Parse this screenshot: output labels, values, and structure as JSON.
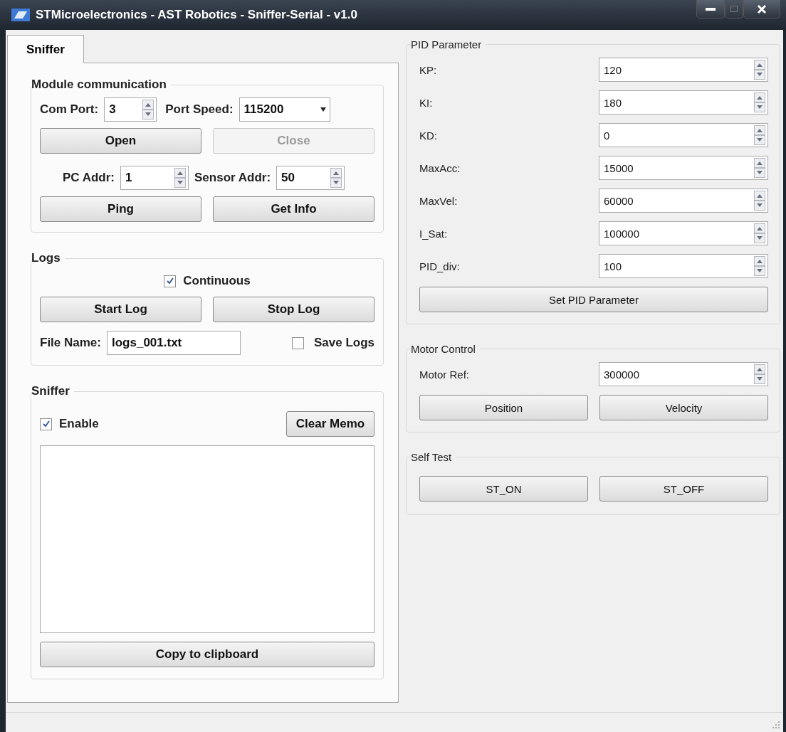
{
  "window": {
    "title": "STMicroelectronics - AST Robotics - Sniffer-Serial - v1.0"
  },
  "tabs": [
    {
      "label": "Sniffer",
      "selected": true
    }
  ],
  "module_communication": {
    "title": "Module communication",
    "com_port": {
      "label": "Com Port:",
      "value": "3"
    },
    "port_speed": {
      "label": "Port Speed:",
      "value": "115200"
    },
    "connect_buttons": [
      {
        "label": "Open",
        "disabled": false
      },
      {
        "label": "Close",
        "disabled": true
      }
    ],
    "pc_addr": {
      "label": "PC Addr:",
      "value": "1"
    },
    "sensor_addr": {
      "label": "Sensor Addr:",
      "value": "50"
    },
    "query_buttons": [
      {
        "label": "Ping",
        "disabled": false
      },
      {
        "label": "Get Info",
        "disabled": false
      }
    ]
  },
  "logs": {
    "title": "Logs",
    "continuous": {
      "label": "Continuous",
      "checked": true
    },
    "buttons": [
      {
        "label": "Start Log",
        "disabled": false
      },
      {
        "label": "Stop Log",
        "disabled": false
      }
    ],
    "file_name": {
      "label": "File Name:",
      "value": "logs_001.txt"
    },
    "save_logs": {
      "label": "Save Logs",
      "checked": false
    }
  },
  "sniffer": {
    "title": "Sniffer",
    "enable": {
      "label": "Enable",
      "checked": true
    },
    "clear_button": "Clear Memo",
    "copy_button": "Copy to clipboard"
  },
  "pid_parameter": {
    "title": "PID Parameter",
    "params": [
      {
        "label": "KP:",
        "value": "120"
      },
      {
        "label": "KI:",
        "value": "180"
      },
      {
        "label": "KD:",
        "value": "0"
      },
      {
        "label": "MaxAcc:",
        "value": "15000"
      },
      {
        "label": "MaxVel:",
        "value": "60000"
      },
      {
        "label": "I_Sat:",
        "value": "100000"
      },
      {
        "label": "PID_div:",
        "value": "100"
      }
    ],
    "button": "Set PID Parameter"
  },
  "motor_control": {
    "title": "Motor Control",
    "motor_ref": {
      "label": "Motor Ref:",
      "value": "300000"
    },
    "buttons": [
      "Position",
      "Velocity"
    ]
  },
  "self_test": {
    "title": "Self Test",
    "buttons": [
      "ST_ON",
      "ST_OFF"
    ]
  }
}
